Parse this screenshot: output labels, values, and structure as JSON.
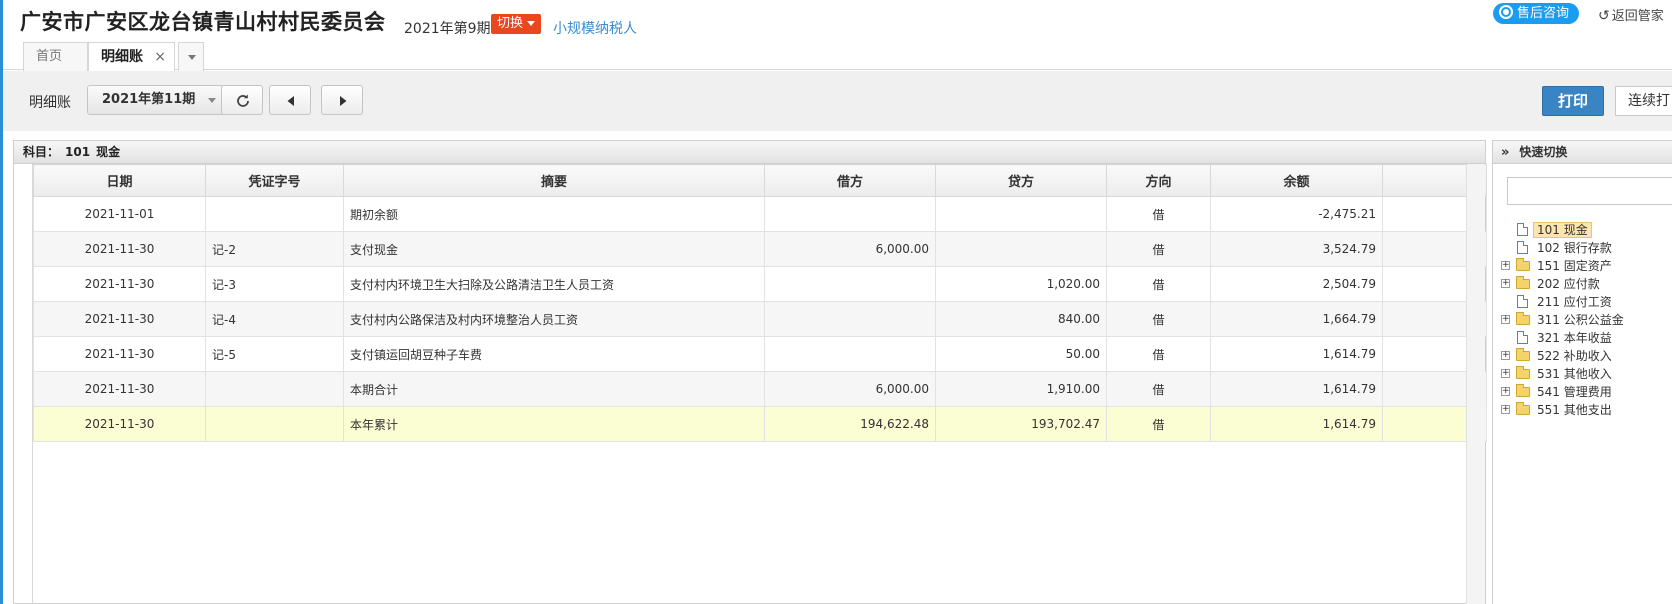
{
  "header": {
    "company": "广安市广安区龙台镇青山村村民委员会",
    "period": "2021年第9期",
    "switch_label": "切换",
    "taxpayer": "小规模纳税人",
    "consult_label": "售后咨询",
    "back_label": "返回管家"
  },
  "tabs": [
    {
      "label": "首页"
    },
    {
      "label": "明细账"
    }
  ],
  "toolbar": {
    "label": "明细账",
    "period_select": "2021年第11期",
    "print_label": "打印",
    "continuous_print_label": "连续打"
  },
  "panel": {
    "subject_prefix": "科目：",
    "subject_code": "101",
    "subject_name": "现金"
  },
  "table": {
    "columns": [
      "日期",
      "凭证字号",
      "摘要",
      "借方",
      "贷方",
      "方向",
      "余额"
    ],
    "rows": [
      {
        "date": "2021-11-01",
        "voucher": "",
        "summary": "期初余额",
        "debit": "",
        "credit": "",
        "direction": "借",
        "balance": "-2,475.21"
      },
      {
        "date": "2021-11-30",
        "voucher": "记-2",
        "summary": "支付现金",
        "debit": "6,000.00",
        "credit": "",
        "direction": "借",
        "balance": "3,524.79"
      },
      {
        "date": "2021-11-30",
        "voucher": "记-3",
        "summary": "支付村内环境卫生大扫除及公路清洁卫生人员工资",
        "debit": "",
        "credit": "1,020.00",
        "direction": "借",
        "balance": "2,504.79"
      },
      {
        "date": "2021-11-30",
        "voucher": "记-4",
        "summary": "支付村内公路保洁及村内环境整治人员工资",
        "debit": "",
        "credit": "840.00",
        "direction": "借",
        "balance": "1,664.79"
      },
      {
        "date": "2021-11-30",
        "voucher": "记-5",
        "summary": "支付镇运回胡豆种子车费",
        "debit": "",
        "credit": "50.00",
        "direction": "借",
        "balance": "1,614.79"
      },
      {
        "date": "2021-11-30",
        "voucher": "",
        "summary": "本期合计",
        "debit": "6,000.00",
        "credit": "1,910.00",
        "direction": "借",
        "balance": "1,614.79"
      },
      {
        "date": "2021-11-30",
        "voucher": "",
        "summary": "本年累计",
        "debit": "194,622.48",
        "credit": "193,702.47",
        "direction": "借",
        "balance": "1,614.79"
      }
    ]
  },
  "side": {
    "title": "快速切换",
    "tree": [
      {
        "label": "101 现金",
        "type": "doc",
        "expandable": false,
        "selected": true
      },
      {
        "label": "102 银行存款",
        "type": "doc",
        "expandable": false,
        "selected": false
      },
      {
        "label": "151 固定资产",
        "type": "folder",
        "expandable": true,
        "selected": false
      },
      {
        "label": "202 应付款",
        "type": "folder",
        "expandable": true,
        "selected": false
      },
      {
        "label": "211 应付工资",
        "type": "doc",
        "expandable": false,
        "selected": false
      },
      {
        "label": "311 公积公益金",
        "type": "folder",
        "expandable": true,
        "selected": false
      },
      {
        "label": "321 本年收益",
        "type": "doc",
        "expandable": false,
        "selected": false
      },
      {
        "label": "522 补助收入",
        "type": "folder",
        "expandable": true,
        "selected": false
      },
      {
        "label": "531 其他收入",
        "type": "folder",
        "expandable": true,
        "selected": false
      },
      {
        "label": "541 管理费用",
        "type": "folder",
        "expandable": true,
        "selected": false
      },
      {
        "label": "551 其他支出",
        "type": "folder",
        "expandable": true,
        "selected": false
      }
    ]
  }
}
